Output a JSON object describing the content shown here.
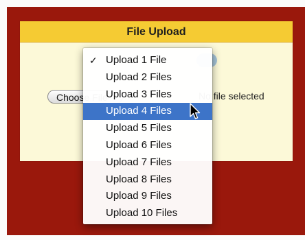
{
  "panel": {
    "title": "File Upload",
    "choose_button_label": "Choose File",
    "file_status": "No file selected"
  },
  "menu": {
    "items": [
      "Upload 1 File",
      "Upload 2 Files",
      "Upload 3 Files",
      "Upload 4 Files",
      "Upload 5 Files",
      "Upload 6 Files",
      "Upload 7 Files",
      "Upload 8 Files",
      "Upload 9 Files",
      "Upload 10 Files"
    ],
    "checked_index": 0,
    "highlighted_index": 3,
    "check_glyph": "✓"
  },
  "colors": {
    "backdrop": "#9a180c",
    "header": "#f5cb33",
    "panel": "#fcf9d8",
    "highlight": "#3d74c8"
  },
  "icons": {
    "cursor": "arrow-cursor-icon",
    "check": "checkmark-icon"
  }
}
